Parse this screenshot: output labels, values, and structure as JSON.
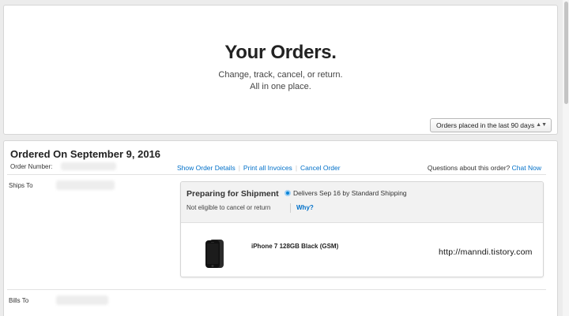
{
  "hero": {
    "title": "Your Orders.",
    "subtitle_line1": "Change, track, cancel, or return.",
    "subtitle_line2": "All in one place.",
    "filter": {
      "selected": "Orders placed in the last 90 days",
      "icon": "chevron-updown-icon"
    }
  },
  "order": {
    "title": "Ordered On September 9, 2016",
    "number_label": "Order Number:",
    "links": {
      "show_details": "Show Order Details",
      "print_invoices": "Print all Invoices",
      "cancel_order": "Cancel Order"
    },
    "questions_text": "Questions about this order?",
    "chat_now": "Chat Now",
    "ships_to_label": "Ships To",
    "bills_to_label": "Bills To",
    "shipment": {
      "status": "Preparing for Shipment",
      "status_color": "#0a84d6",
      "delivers": "Delivers Sep 16 by Standard Shipping",
      "cancel_note": "Not eligible to cancel or return",
      "why_link": "Why?",
      "product_name": "iPhone 7 128GB Black (GSM)",
      "product_icon": "iphone-image"
    }
  },
  "watermark": "http://manndi.tistory.com",
  "colors": {
    "link": "#0070c9",
    "background": "#ececec"
  }
}
